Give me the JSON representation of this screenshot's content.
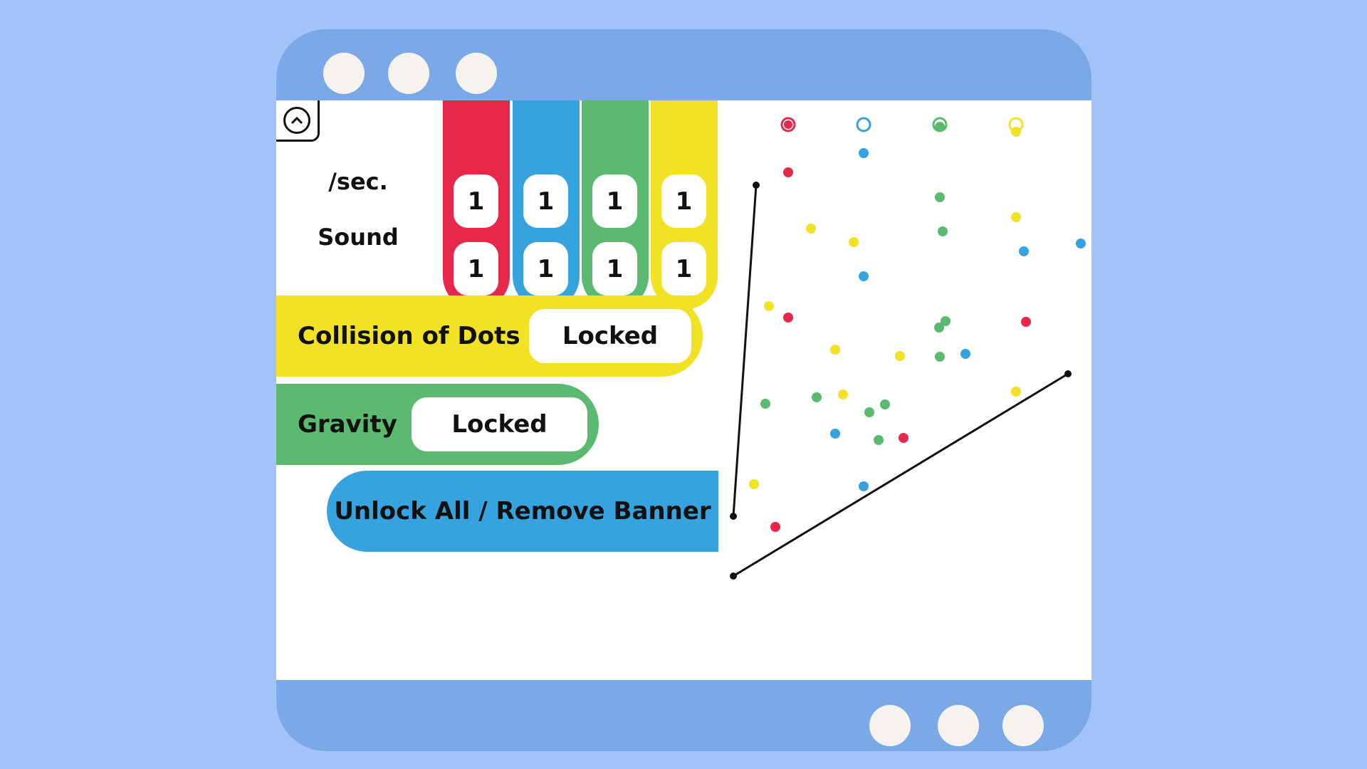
{
  "colors": {
    "background": "#a2c3f7",
    "window_chrome": "#7ba9e7",
    "window_button": "#f6f3ef",
    "red": "#e6284a",
    "blue": "#36a3de",
    "green": "#5bba6f",
    "yellow": "#f2e226",
    "ink": "#111111"
  },
  "window": {
    "title_buttons": [
      "circle",
      "circle",
      "circle"
    ],
    "bottom_buttons": [
      "circle",
      "circle",
      "circle"
    ]
  },
  "panel": {
    "collapse_icon": "chevron-up-circle-icon",
    "row_labels": {
      "per_sec": "/sec.",
      "sound": "Sound"
    },
    "columns": [
      {
        "color_name": "red",
        "per_sec": "1",
        "sound": "1"
      },
      {
        "color_name": "blue",
        "per_sec": "1",
        "sound": "1"
      },
      {
        "color_name": "green",
        "per_sec": "1",
        "sound": "1"
      },
      {
        "color_name": "yellow",
        "per_sec": "1",
        "sound": "1"
      }
    ],
    "collision": {
      "label": "Collision of Dots",
      "value": "Locked"
    },
    "gravity": {
      "label": "Gravity",
      "value": "Locked"
    },
    "unlock_button": "Unlock All / Remove Banner"
  },
  "field": {
    "emitters": [
      {
        "color": "red",
        "style": "filled-ring"
      },
      {
        "color": "blue",
        "style": "hollow-ring"
      },
      {
        "color": "green",
        "style": "half-filled-ring"
      },
      {
        "color": "yellow",
        "style": "ring-with-drop"
      }
    ],
    "dot_counts": {
      "red": 5,
      "blue": 7,
      "green": 10,
      "yellow": 9
    },
    "lines_drawn": 2
  }
}
